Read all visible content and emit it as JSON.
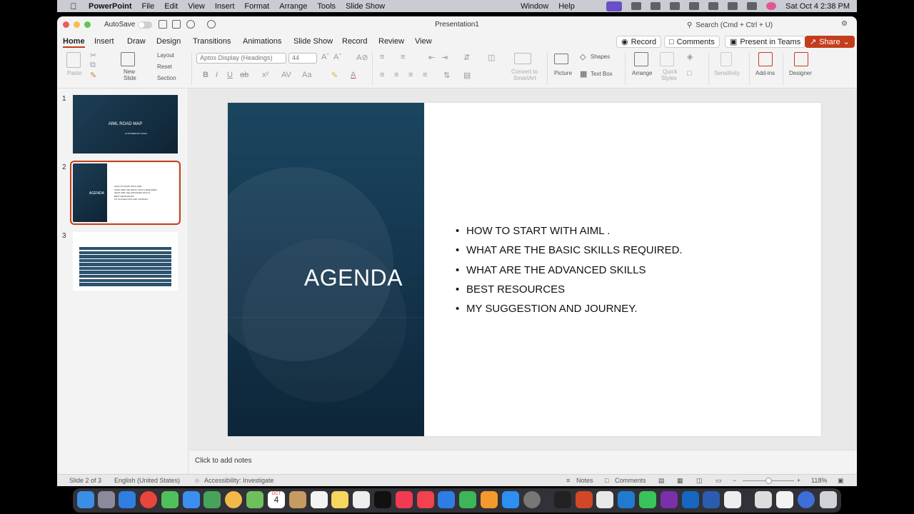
{
  "menubar": {
    "app_name": "PowerPoint",
    "items": [
      "File",
      "Edit",
      "View",
      "Insert",
      "Format",
      "Arrange",
      "Tools",
      "Slide Show",
      "Window",
      "Help"
    ],
    "datetime": "Sat Oct 4  2:38 PM"
  },
  "titlebar": {
    "autosave_label": "AutoSave",
    "document_title": "Presentation1",
    "search_placeholder": "Search (Cmd + Ctrl + U)"
  },
  "ribbon_tabs": [
    "Home",
    "Insert",
    "Draw",
    "Design",
    "Transitions",
    "Animations",
    "Slide Show",
    "Record",
    "Review",
    "View"
  ],
  "ribbon_tabs_active": "Home",
  "ribbon_buttons": {
    "record": "Record",
    "comments": "Comments",
    "present_teams": "Present in Teams",
    "share": "Share"
  },
  "ribbon": {
    "paste": "Paste",
    "new_slide": "New",
    "new_slide_2": "Slide",
    "layout": "Layout",
    "reset": "Reset",
    "section": "Section",
    "font_name": "Aptos Display (Headings)",
    "font_size": "44",
    "convert_smartart_1": "Convert to",
    "convert_smartart_2": "SmartArt",
    "picture": "Picture",
    "shapes": "Shapes",
    "text_box": "Text Box",
    "arrange": "Arrange",
    "quick_styles_1": "Quick",
    "quick_styles_2": "Styles",
    "sensitivity": "Sensitivity",
    "add_ins": "Add-ins",
    "designer": "Designer"
  },
  "thumbnails": {
    "numbers": [
      "1",
      "2",
      "3"
    ],
    "slide1_title": "AIML ROAD MAP",
    "slide1_subtitle": "AI STORIES BY MUKU",
    "slide2_title": "AGENDA",
    "slide3_rows": [
      "",
      "",
      "",
      "",
      "",
      "",
      "",
      "",
      "",
      ""
    ]
  },
  "slide": {
    "title": "AGENDA",
    "bullets": [
      "HOW TO START WITH AIML .",
      "WHAT ARE THE BASIC SKILLS REQUIRED.",
      "WHAT ARE THE ADVANCED SKILLS",
      "BEST RESOURCES",
      "MY SUGGESTION AND JOURNEY."
    ]
  },
  "notes_placeholder": "Click to add notes",
  "status": {
    "slide_count": "Slide 2 of 3",
    "language": "English (United States)",
    "accessibility": "Accessibility: Investigate",
    "notes": "Notes",
    "comments": "Comments",
    "zoom": "118%"
  },
  "dock_calendar": {
    "month": "OCT",
    "day": "4"
  }
}
